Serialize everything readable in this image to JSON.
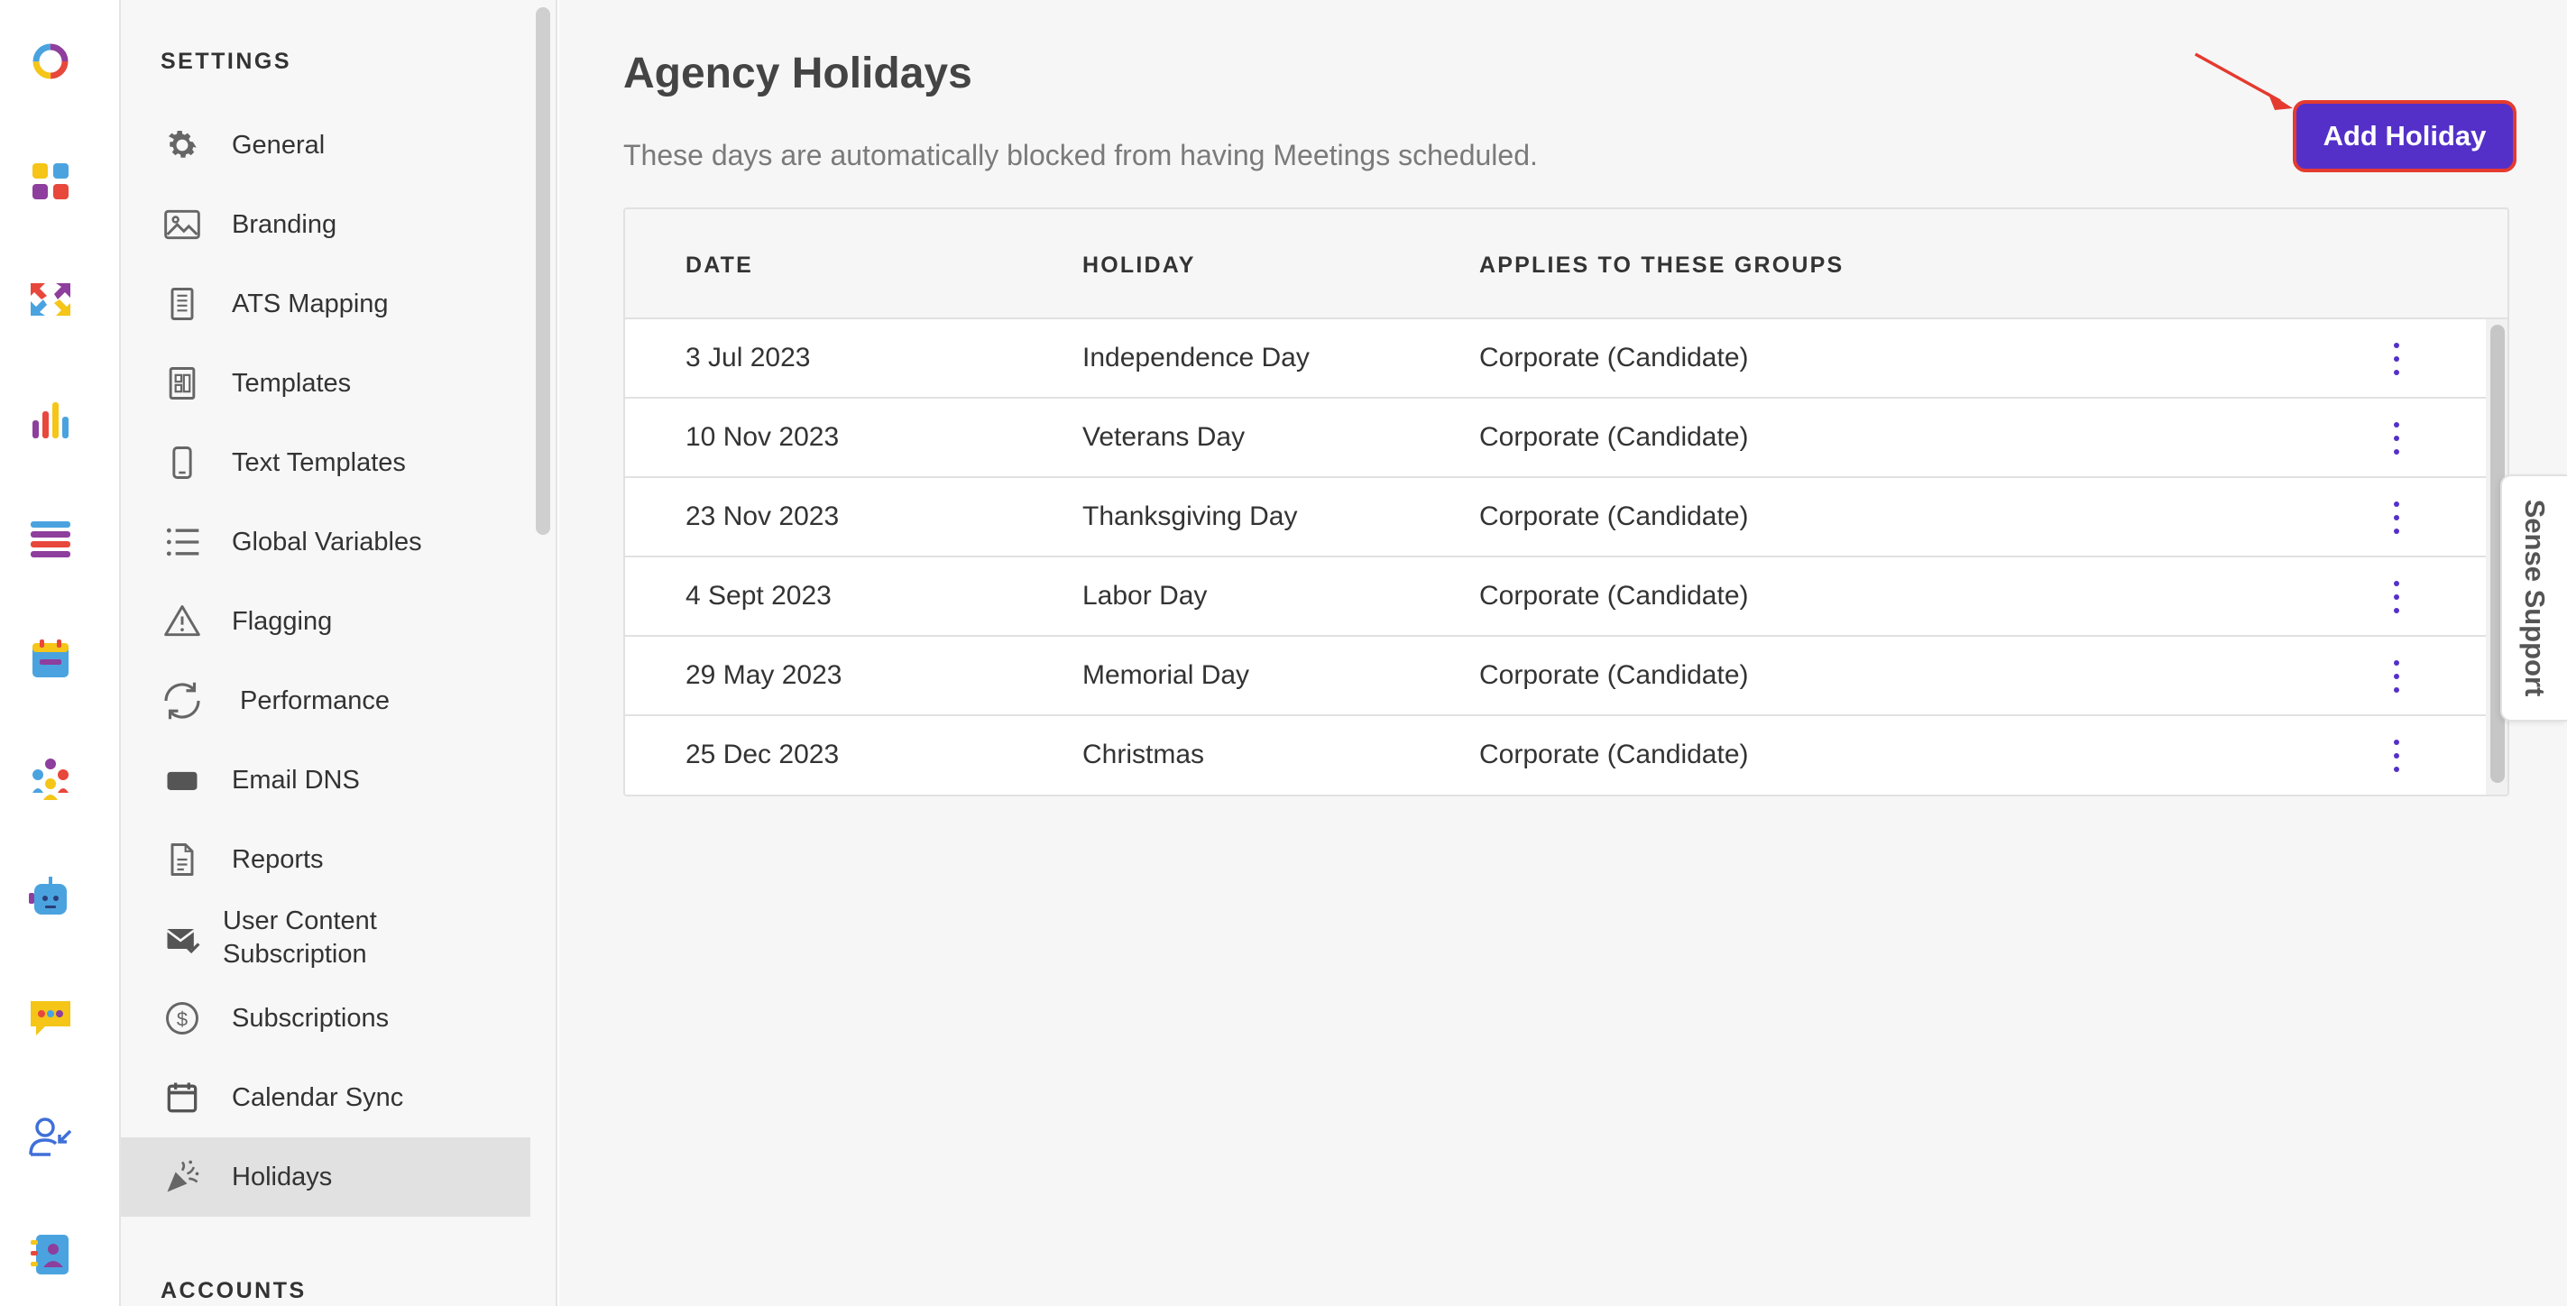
{
  "sidebar": {
    "section_heading": "SETTINGS",
    "accounts_heading": "ACCOUNTS",
    "items": [
      {
        "label": "General",
        "icon": "gear-icon"
      },
      {
        "label": "Branding",
        "icon": "image-icon"
      },
      {
        "label": "ATS Mapping",
        "icon": "document-icon"
      },
      {
        "label": "Templates",
        "icon": "template-icon"
      },
      {
        "label": "Text Templates",
        "icon": "phone-icon"
      },
      {
        "label": "Global Variables",
        "icon": "list-icon"
      },
      {
        "label": "Flagging",
        "icon": "warning-icon"
      },
      {
        "label": "Performance",
        "icon": "refresh-icon"
      },
      {
        "label": "Email DNS",
        "icon": "email-dns-icon"
      },
      {
        "label": "Reports",
        "icon": "report-icon"
      },
      {
        "label": "User Content Subscription",
        "label_line1": "User Content",
        "label_line2": "Subscription",
        "icon": "mail-check-icon"
      },
      {
        "label": "Subscriptions",
        "icon": "dollar-icon"
      },
      {
        "label": "Calendar Sync",
        "icon": "calendar-icon"
      },
      {
        "label": "Holidays",
        "icon": "party-popper-icon",
        "active": true
      }
    ]
  },
  "main": {
    "title": "Agency Holidays",
    "subtitle": "These days are automatically blocked from having Meetings scheduled.",
    "add_button": "Add Holiday",
    "table": {
      "columns": [
        "DATE",
        "HOLIDAY",
        "APPLIES TO THESE GROUPS"
      ],
      "rows": [
        {
          "date": "3 Jul 2023",
          "holiday": "Independence Day",
          "groups": "Corporate (Candidate)"
        },
        {
          "date": "10 Nov 2023",
          "holiday": "Veterans Day",
          "groups": "Corporate (Candidate)"
        },
        {
          "date": "23 Nov 2023",
          "holiday": "Thanksgiving Day",
          "groups": "Corporate (Candidate)"
        },
        {
          "date": "4 Sept 2023",
          "holiday": "Labor Day",
          "groups": "Corporate (Candidate)"
        },
        {
          "date": "29 May 2023",
          "holiday": "Memorial Day",
          "groups": "Corporate (Candidate)"
        },
        {
          "date": "25 Dec 2023",
          "holiday": "Christmas",
          "groups": "Corporate (Candidate)"
        }
      ]
    }
  },
  "support_tab": "Sense Support",
  "colors": {
    "accent": "#5430c9",
    "highlight_border": "#e53a2f",
    "active_nav_bg": "#e1e1e1"
  }
}
